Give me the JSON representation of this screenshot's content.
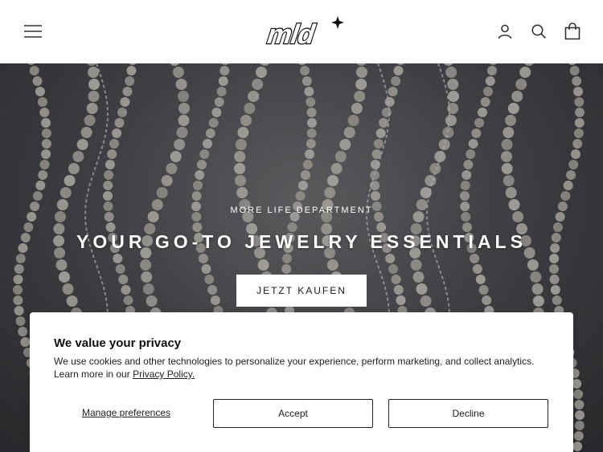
{
  "header": {
    "menu_icon": "hamburger-menu-icon",
    "logo_text": "mld",
    "icons": [
      "account-icon",
      "search-icon",
      "cart-icon"
    ]
  },
  "hero": {
    "subtitle": "MORE LIFE DEPARTMENT",
    "title": "YOUR GO-TO JEWELRY ESSENTIALS",
    "cta_label": "JETZT KAUFEN"
  },
  "cookie_banner": {
    "title": "We value your privacy",
    "text": "We use cookies and other technologies to personalize your experience, perform marketing, and collect analytics. Learn more in our ",
    "privacy_link": "Privacy Policy.",
    "manage_label": "Manage preferences",
    "accept_label": "Accept",
    "decline_label": "Decline"
  }
}
